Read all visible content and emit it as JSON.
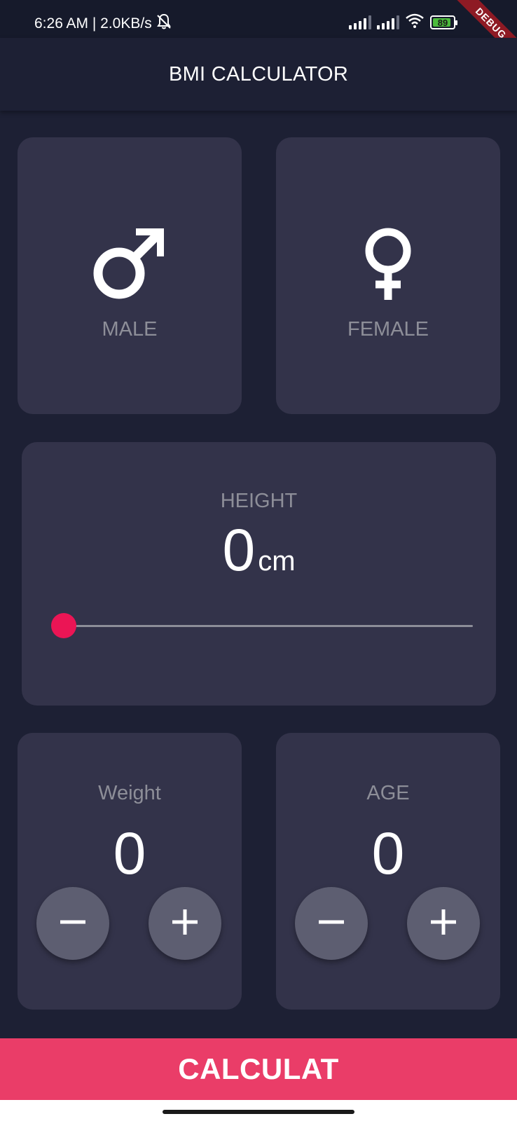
{
  "status_bar": {
    "time": "6:26 AM | 2.0KB/s",
    "battery_level": "89",
    "battery_fraction": 0.89,
    "icons": [
      "bell-off-icon",
      "signal-icon",
      "signal-icon",
      "wifi-icon",
      "battery-icon"
    ]
  },
  "debug_banner": "DEBUG",
  "app_bar": {
    "title": "BMI CALCULATOR"
  },
  "gender": {
    "male": {
      "label": "MALE",
      "icon": "male-symbol-icon"
    },
    "female": {
      "label": "FEMALE",
      "icon": "female-symbol-icon"
    }
  },
  "height": {
    "label": "HEIGHT",
    "value": "0",
    "unit": "cm",
    "slider_fraction": 0
  },
  "weight": {
    "label": "Weight",
    "value": "0",
    "minus_icon": "minus-icon",
    "plus_icon": "plus-icon"
  },
  "age": {
    "label": "AGE",
    "value": "0",
    "minus_icon": "minus-icon",
    "plus_icon": "plus-icon"
  },
  "calculate_button": {
    "label": "CALCULAT"
  },
  "colors": {
    "background": "#1d2034",
    "card": "#33334a",
    "accent": "#eb1555",
    "button": "#ea3d68",
    "label": "#8d8e98",
    "round_button": "#5d5e71"
  }
}
